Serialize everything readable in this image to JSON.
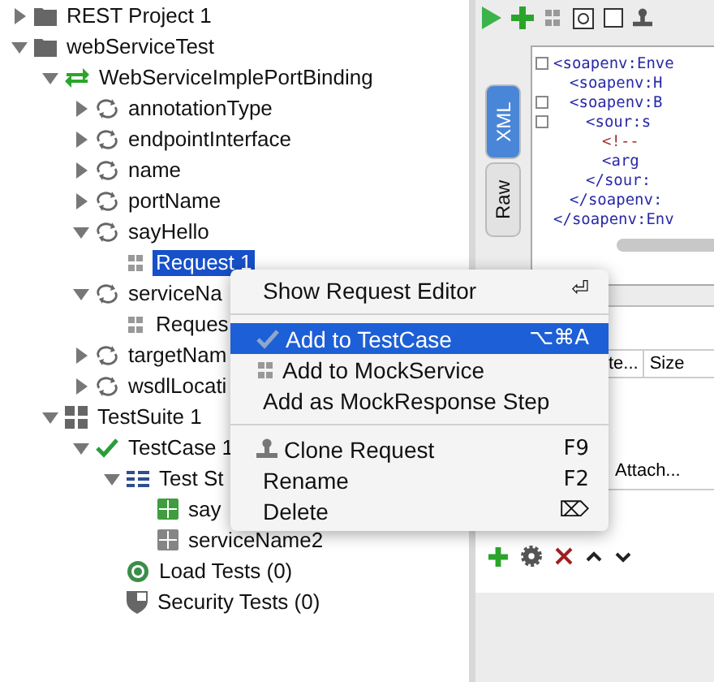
{
  "tree": [
    {
      "label": "REST Project 1",
      "kind": "folder",
      "expanded": false,
      "selected": false
    },
    {
      "label": "webServiceTest",
      "kind": "folder",
      "expanded": true,
      "selected": false,
      "children": [
        {
          "label": "WebServiceImplePortBinding",
          "kind": "binding",
          "expanded": true,
          "selected": false,
          "children": [
            {
              "label": "annotationType",
              "kind": "operation",
              "expanded": false,
              "selected": false
            },
            {
              "label": "endpointInterface",
              "kind": "operation",
              "expanded": false,
              "selected": false
            },
            {
              "label": "name",
              "kind": "operation",
              "expanded": false,
              "selected": false
            },
            {
              "label": "portName",
              "kind": "operation",
              "expanded": false,
              "selected": false
            },
            {
              "label": "sayHello",
              "kind": "operation",
              "expanded": true,
              "selected": false,
              "children": [
                {
                  "label": "Request 1",
                  "kind": "request",
                  "selected": true
                }
              ]
            },
            {
              "label": "serviceNa",
              "kind": "operation",
              "expanded": true,
              "selected": false,
              "children": [
                {
                  "label": "Reques",
                  "kind": "request",
                  "selected": false
                }
              ]
            },
            {
              "label": "targetNam",
              "kind": "operation",
              "expanded": false,
              "selected": false
            },
            {
              "label": "wsdlLocati",
              "kind": "operation",
              "expanded": false,
              "selected": false
            }
          ]
        },
        {
          "label": "TestSuite 1",
          "kind": "suite",
          "expanded": true,
          "selected": false,
          "children": [
            {
              "label": "TestCase 1",
              "kind": "testcase",
              "expanded": true,
              "selected": false,
              "children": [
                {
                  "label": "Test St",
                  "kind": "steps",
                  "expanded": true,
                  "selected": false,
                  "children": [
                    {
                      "label": "say",
                      "kind": "step",
                      "color": "#3f9c3f",
                      "selected": false
                    },
                    {
                      "label": "serviceName2",
                      "kind": "step",
                      "color": "#858585",
                      "selected": false
                    }
                  ]
                },
                {
                  "label": "Load Tests (0)",
                  "kind": "load",
                  "selected": false
                },
                {
                  "label": "Security Tests (0)",
                  "kind": "security",
                  "selected": false
                }
              ]
            }
          ]
        }
      ]
    }
  ],
  "editor": {
    "tabs": [
      {
        "label": "XML",
        "selected": true
      },
      {
        "label": "Raw",
        "selected": false
      }
    ],
    "lines": [
      {
        "text": "<soapenv:Enve",
        "kind": "tag",
        "children": [
          {
            "text": "<soapenv:H",
            "kind": "tag"
          },
          {
            "text": "<soapenv:B",
            "kind": "tag",
            "children": [
              {
                "text": "<sour:s",
                "kind": "tag",
                "children": [
                  {
                    "text": "<!--",
                    "kind": "comment"
                  },
                  {
                    "text": "<arg",
                    "kind": "tag"
                  }
                ]
              },
              {
                "text": "</sour:",
                "kind": "tag"
              }
            ]
          },
          {
            "text": "</soapenv:",
            "kind": "tag"
          }
        ]
      },
      {
        "text": "</soapenv:Env",
        "kind": "tag"
      }
    ]
  },
  "attachments": {
    "columns": [
      "te...",
      "Size"
    ],
    "row_text": "Attach..."
  },
  "context_menu": {
    "items": [
      {
        "kind": "plain",
        "label": "Show Request Editor",
        "shortcut": "⏎",
        "selected": false
      },
      {
        "kind": "divider"
      },
      {
        "kind": "check",
        "label": "Add to TestCase",
        "shortcut": "⌥⌘A",
        "selected": true
      },
      {
        "kind": "soap",
        "label": "Add to MockService",
        "selected": false
      },
      {
        "kind": "plain",
        "label": "Add as MockResponse Step",
        "selected": false
      },
      {
        "kind": "divider"
      },
      {
        "kind": "stamp",
        "label": "Clone Request",
        "shortcut": "F9",
        "selected": false
      },
      {
        "kind": "plain",
        "label": "Rename",
        "shortcut": "F2",
        "selected": false
      },
      {
        "kind": "plain",
        "label": "Delete",
        "shortcut": "⌦",
        "selected": false
      }
    ]
  }
}
